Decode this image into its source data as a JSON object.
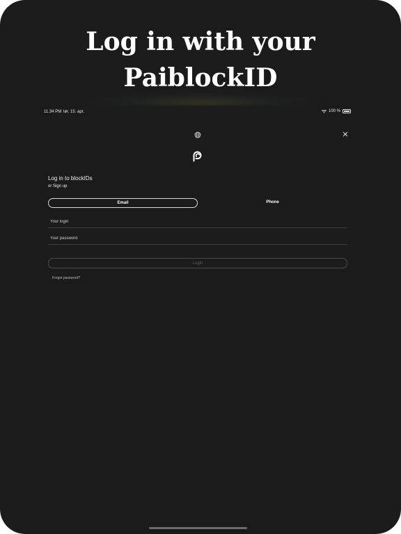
{
  "hero": {
    "title_line1": "Log in with your",
    "title_line2": "PaiblockID"
  },
  "status_bar": {
    "time": "11.34 PM",
    "date": "lør. 15. apr.",
    "battery": "100 %",
    "icons": [
      "wifi-icon",
      "battery-icon"
    ]
  },
  "toolbar": {
    "language_icon": "globe-icon",
    "close_icon": "close-icon"
  },
  "brand": {
    "logo_icon": "paiblock-logo"
  },
  "form": {
    "heading": "Log in to blockIDs",
    "signup_prefix": "or",
    "signup_link": "Sign up",
    "tabs": [
      {
        "label": "Email",
        "selected": true
      },
      {
        "label": "Phone",
        "selected": false
      }
    ],
    "login_placeholder": "Your login",
    "password_placeholder": "Your password",
    "login_button": "Login",
    "forgot_password": "Forgot password?"
  },
  "colors": {
    "background": "#1b1b1b",
    "text": "#ffffff",
    "disabled_text": "#5e5e5e"
  }
}
